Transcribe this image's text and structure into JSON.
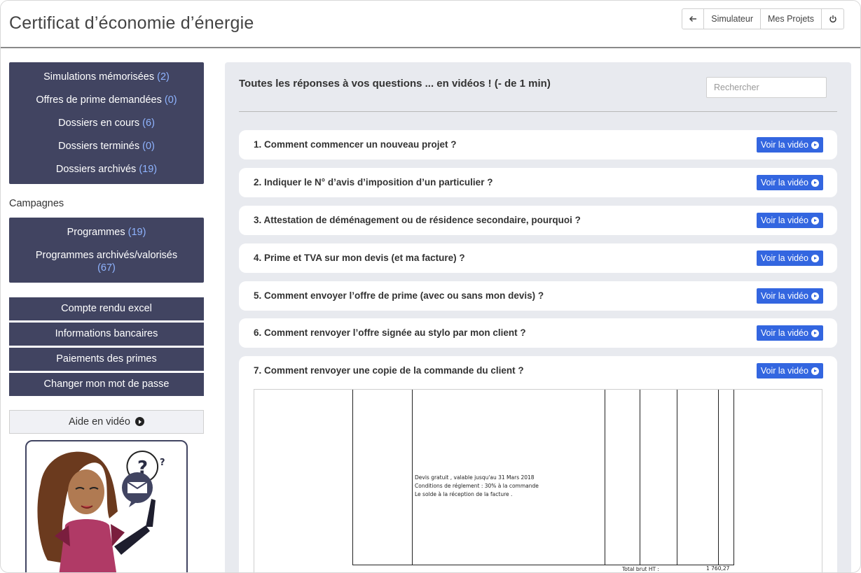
{
  "header": {
    "title": "Certificat d’économie d’énergie",
    "nav": {
      "simulator": "Simulateur",
      "projects": "Mes Projets"
    }
  },
  "sidebar": {
    "stats": [
      {
        "label": "Simulations mémorisées",
        "count": "(2)"
      },
      {
        "label": "Offres de prime demandées",
        "count": "(0)"
      },
      {
        "label": "Dossiers en cours",
        "count": "(6)"
      },
      {
        "label": "Dossiers terminés",
        "count": "(0)"
      },
      {
        "label": "Dossiers archivés",
        "count": "(19)"
      }
    ],
    "campaigns_label": "Campagnes",
    "campaigns": [
      {
        "label": "Programmes ",
        "count": "(19)"
      },
      {
        "label": "Programmes archivés/valorisés",
        "count": "(67)"
      }
    ],
    "buttons": {
      "report": "Compte rendu excel",
      "bank": "Informations bancaires",
      "payments": "Paiements des primes",
      "password": "Changer mon mot de passe"
    },
    "help": "Aide en vidéo"
  },
  "main": {
    "heading": "Toutes les réponses à vos questions ... en vidéos ! (- de 1 min)",
    "search_placeholder": "Rechercher",
    "video_label": "Voir la vidéo",
    "faq": [
      "1. Comment commencer un nouveau projet ?",
      "2. Indiquer le N° d’avis d’imposition d’un particulier ?",
      "3. Attestation de déménagement ou de résidence secondaire, pourquoi ?",
      "4. Prime et TVA sur mon devis (et ma facture) ?",
      "5. Comment envoyer l’offre de prime (avec ou sans mon devis) ?",
      "6. Comment renvoyer l’offre signée au stylo par mon client ?",
      "7. Comment renvoyer une copie de la commande du client ?"
    ],
    "document": {
      "line1": "Devis gratuit , valable jusqu'au 31 Mars 2018",
      "line2": "Conditions de réglement : 30% à la commande",
      "line3": "Le solde à la réception de la facture .",
      "total_label": "Total brut HT :",
      "total_value": "1 760,27"
    }
  },
  "colors": {
    "nav_bg": "#414461",
    "accent": "#3366e0",
    "count": "#8fb4ff"
  }
}
